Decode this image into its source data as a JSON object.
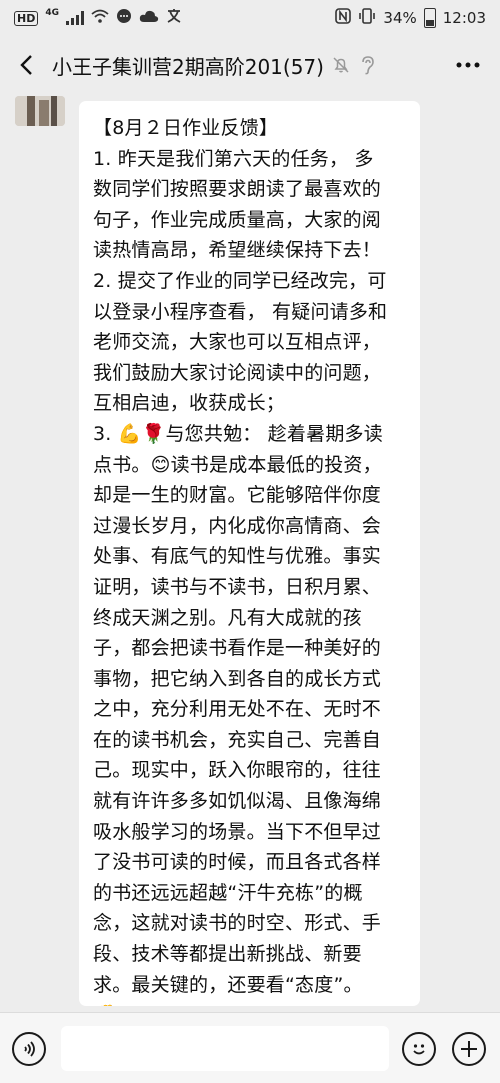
{
  "status_bar": {
    "hd": "HD",
    "network": "4G",
    "battery": "34%",
    "time": "12:03",
    "icons": [
      "hd-icon",
      "signal-icon",
      "wifi-icon",
      "dialog-icon",
      "cloud-icon",
      "translate-icon",
      "nfc-icon",
      "vibrate-icon",
      "battery-icon"
    ]
  },
  "header": {
    "title": "小王子集训营2期高阶201(57)",
    "icons": [
      "back-icon",
      "mute-icon",
      "earpiece-icon",
      "more-icon"
    ]
  },
  "message": {
    "lines": [
      "【8月２日作业反馈】",
      "1. 昨天是我们第六天的任务，  多",
      "数同学们按照要求朗读了最喜欢的",
      "句子，作业完成质量高，大家的阅",
      "读热情高昂，希望继续保持下去！",
      "2. 提交了作业的同学已经改完，可",
      "以登录小程序查看，  有疑问请多和",
      "老师交流，大家也可以互相点评，",
      "我们鼓励大家讨论阅读中的问题，",
      "互相启迪，收获成长；",
      "3. 💪🌹与您共勉：   趁着暑期多读",
      "点书。😊读书是成本最低的投资，",
      "却是一生的财富。它能够陪伴你度",
      "过漫长岁月，内化成你高情商、会",
      "处事、有底气的知性与优雅。事实",
      "证明，读书与不读书，日积月累、",
      "终成天渊之别。凡有大成就的孩",
      "子，都会把读书看作是一种美好的",
      "事物，把它纳入到各自的成长方式",
      "之中，充分利用无处不在、无时不",
      "在的读书机会，充实自己、完善自",
      "己。现实中，跃入你眼帘的，往往",
      "就有许许多多如饥似渴、且像海绵",
      "吸水般学习的场景。当下不但早过",
      "了没书可读的时候，而且各式各样",
      "的书还远远超越“汗牛充栋”的概",
      "念，这就对读书的时空、形式、手",
      "段、技术等都提出新挑战、新要",
      "求。最关键的，还要看“态度”。",
      "✊"
    ]
  },
  "input_bar": {
    "placeholder": "",
    "icons": [
      "voice-icon",
      "emoji-icon",
      "plus-icon"
    ]
  },
  "colors": {
    "background": "#ededed",
    "bubble": "#ffffff",
    "input_bar": "#f6f6f6"
  }
}
